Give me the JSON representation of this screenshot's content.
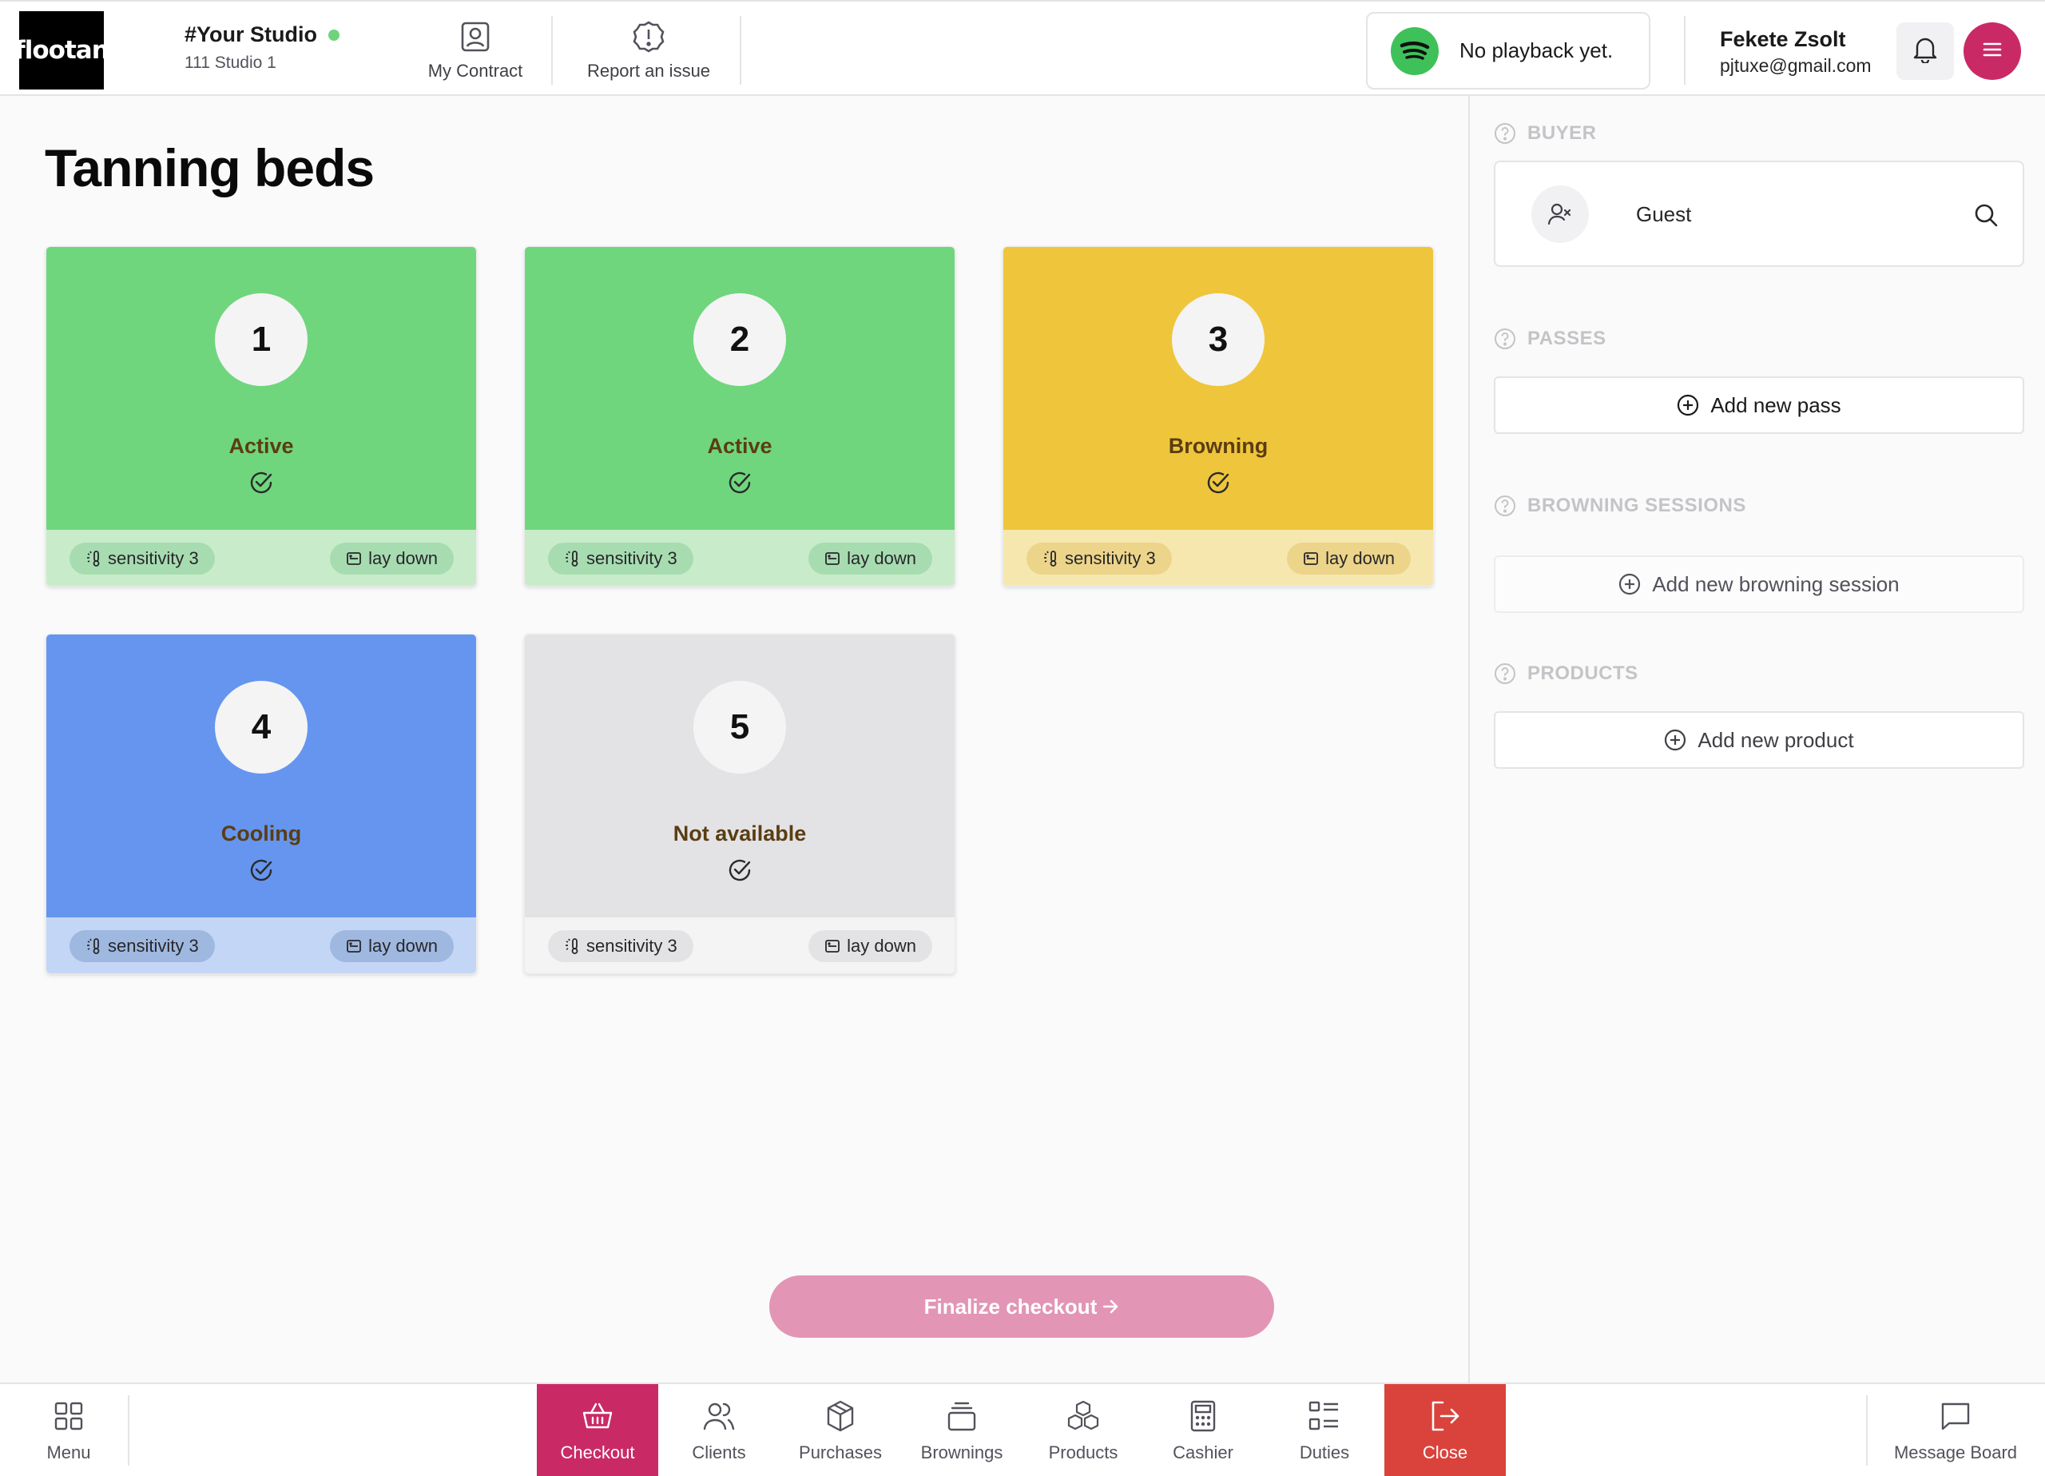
{
  "header": {
    "logo_text": "flootan",
    "studio_name": "#Your Studio",
    "studio_sub": "111 Studio 1",
    "my_contract": "My Contract",
    "report_issue": "Report an issue",
    "spotify_status": "No playback yet.",
    "user_name": "Fekete Zsolt",
    "user_email": "pjtuxe@gmail.com"
  },
  "main": {
    "title": "Tanning beds",
    "finalize_label": "Finalize checkout",
    "beds": [
      {
        "number": "1",
        "status": "Active",
        "sensitivity": "sensitivity 3",
        "position": "lay down",
        "color": "green"
      },
      {
        "number": "2",
        "status": "Active",
        "sensitivity": "sensitivity 3",
        "position": "lay down",
        "color": "green"
      },
      {
        "number": "3",
        "status": "Browning",
        "sensitivity": "sensitivity 3",
        "position": "lay down",
        "color": "yellow"
      },
      {
        "number": "4",
        "status": "Cooling",
        "sensitivity": "sensitivity 3",
        "position": "lay down",
        "color": "blue"
      },
      {
        "number": "5",
        "status": "Not available",
        "sensitivity": "sensitivity 3",
        "position": "lay down",
        "color": "gray"
      }
    ]
  },
  "panel": {
    "buyer_heading": "BUYER",
    "buyer_name": "Guest",
    "passes_heading": "PASSES",
    "add_pass": "Add new pass",
    "browning_heading": "BROWNING SESSIONS",
    "add_browning": "Add new browning session",
    "products_heading": "PRODUCTS",
    "add_product": "Add new product"
  },
  "bottom_nav": {
    "menu": "Menu",
    "checkout": "Checkout",
    "clients": "Clients",
    "purchases": "Purchases",
    "brownings": "Brownings",
    "products": "Products",
    "cashier": "Cashier",
    "duties": "Duties",
    "close": "Close",
    "message_board": "Message Board"
  },
  "colors": {
    "brand": "#c92a65",
    "active_green": "#6fd67d",
    "browning_yellow": "#efc63b",
    "cooling_blue": "#6595ef",
    "unavailable_gray": "#e3e3e6",
    "close_red": "#d9433c"
  }
}
